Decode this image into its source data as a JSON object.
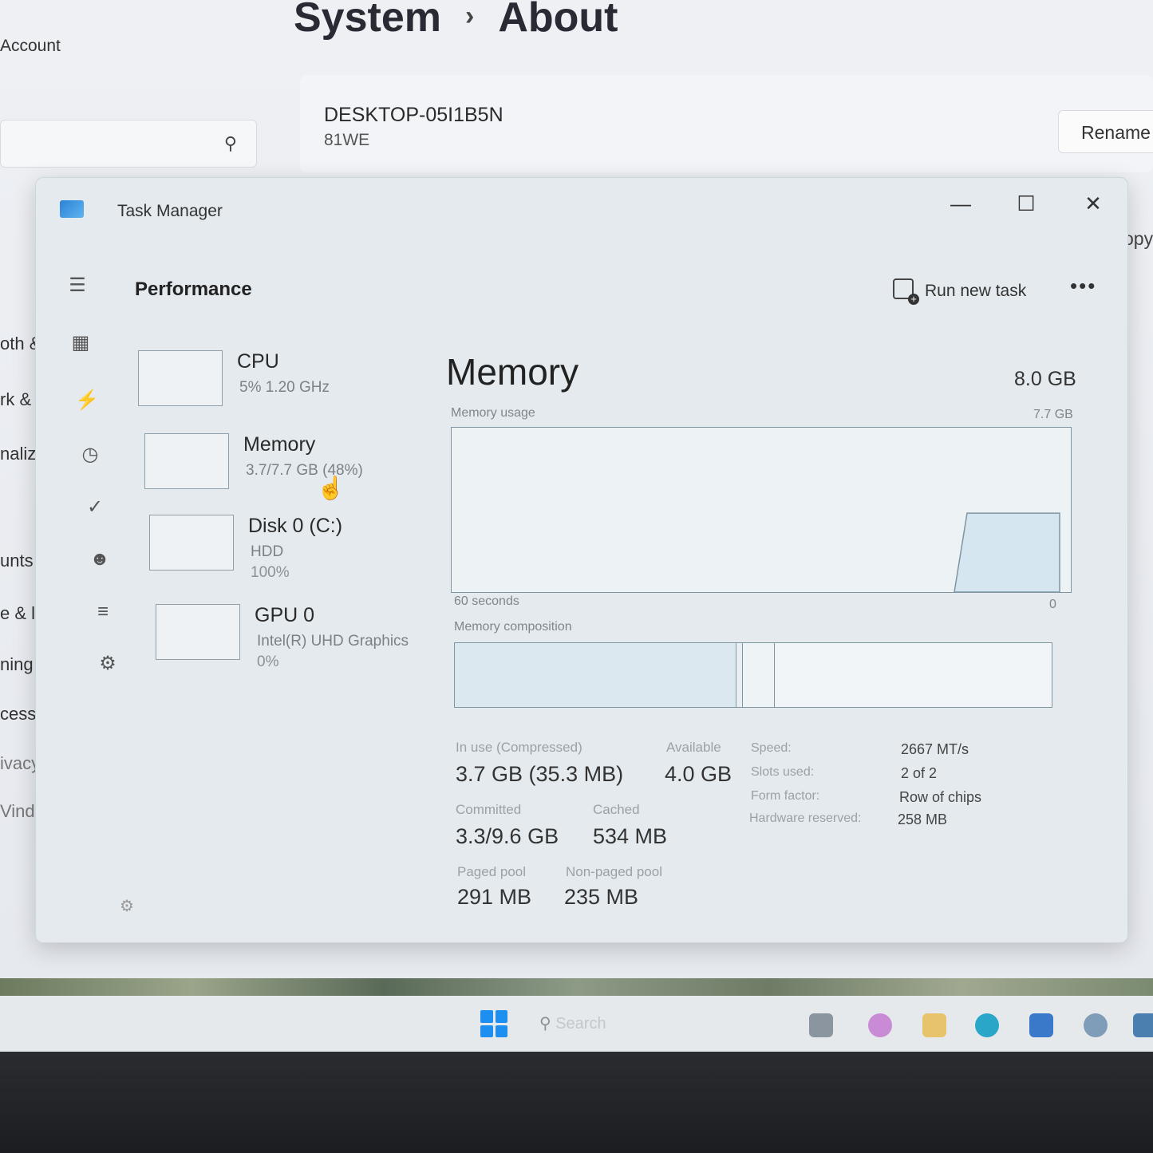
{
  "settings": {
    "breadcrumb_parent": "System",
    "breadcrumb_sep": "›",
    "breadcrumb_current": "About",
    "account_label": "Account",
    "device_name": "DESKTOP-05I1B5N",
    "device_model": "81WE",
    "rename_label": "Rename",
    "copy_label_1": "opy",
    "copy_label_2": "opy",
    "nav_fragments": [
      "oth &",
      "rk & ir",
      "nalizati",
      "unts",
      "e & langu",
      "ning",
      "cessibility",
      "ivacy & sec",
      "Vindows Up"
    ]
  },
  "task_manager": {
    "title": "Task Manager",
    "minimize": "—",
    "maximize": "☐",
    "close": "✕",
    "page_title": "Performance",
    "run_new_task": "Run new task",
    "more": "•••",
    "resources": [
      {
        "name": "CPU",
        "sub": "5%  1.20 GHz",
        "sub2": ""
      },
      {
        "name": "Memory",
        "sub": "3.7/7.7 GB (48%)",
        "sub2": ""
      },
      {
        "name": "Disk 0 (C:)",
        "sub": "HDD",
        "sub2": "100%"
      },
      {
        "name": "GPU 0",
        "sub": "Intel(R) UHD Graphics",
        "sub2": "0%"
      }
    ],
    "memory": {
      "heading": "Memory",
      "total": "8.0 GB",
      "usage_label": "Memory usage",
      "usage_max": "7.7 GB",
      "time_label": "60 seconds",
      "time_zero": "0",
      "composition_label": "Memory composition",
      "usage_level": 0.48,
      "stats": {
        "in_use_label": "In use (Compressed)",
        "in_use_value": "3.7 GB (35.3 MB)",
        "available_label": "Available",
        "available_value": "4.0 GB",
        "committed_label": "Committed",
        "committed_value": "3.3/9.6 GB",
        "cached_label": "Cached",
        "cached_value": "534 MB",
        "paged_label": "Paged pool",
        "paged_value": "291 MB",
        "nonpaged_label": "Non-paged pool",
        "nonpaged_value": "235 MB"
      },
      "details": {
        "speed_label": "Speed:",
        "speed_value": "2667 MT/s",
        "slots_label": "Slots used:",
        "slots_value": "2 of 2",
        "form_label": "Form factor:",
        "form_value": "Row of chips",
        "hw_label": "Hardware reserved:",
        "hw_value": "258 MB"
      }
    }
  },
  "taskbar": {
    "search_placeholder": "Search"
  },
  "colors": {
    "accent": "#1f6fd1",
    "graph_border": "#7e95a2",
    "graph_fill": "#d6e6f0"
  }
}
